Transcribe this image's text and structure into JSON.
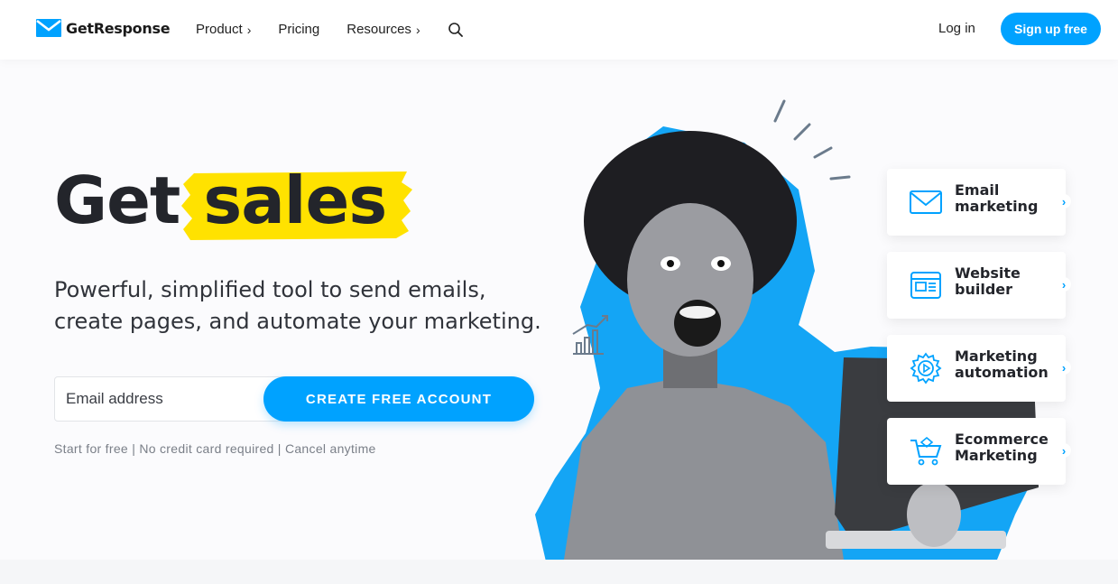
{
  "brand": {
    "name": "GetResponse",
    "accent": "#00a2ff",
    "highlight": "#ffe200"
  },
  "nav": {
    "items": [
      {
        "label": "Product",
        "chevron": "›"
      },
      {
        "label": "Pricing",
        "chevron": ""
      },
      {
        "label": "Resources",
        "chevron": "›"
      }
    ],
    "search_icon": "search-icon",
    "login": "Log in",
    "signup": "Sign up free"
  },
  "hero": {
    "title_plain": "Get",
    "title_highlight": "sales",
    "subtitle": "Powerful, simplified tool to send emails, create pages, and automate your marketing.",
    "email_placeholder": "Email address",
    "cta": "CREATE FREE ACCOUNT",
    "note": "Start for free | No credit card required | Cancel anytime"
  },
  "cards": [
    {
      "label": "Email marketing",
      "icon": "envelope-icon"
    },
    {
      "label": "Website builder",
      "icon": "webpage-icon"
    },
    {
      "label": "Marketing automation",
      "icon": "gear-play-icon"
    },
    {
      "label": "Ecommerce Marketing",
      "icon": "cart-icon"
    }
  ]
}
